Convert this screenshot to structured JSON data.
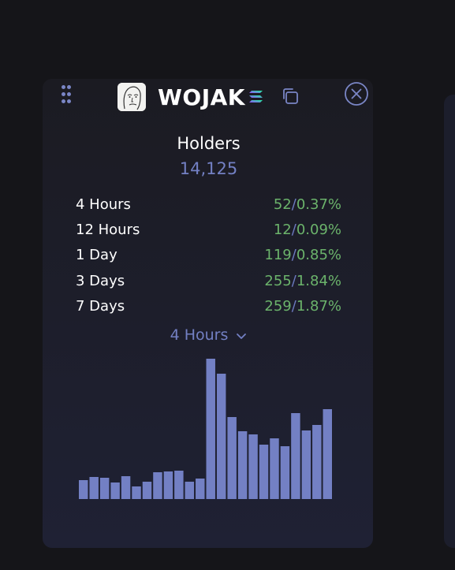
{
  "token": {
    "name": "WOJAK",
    "avatar_icon": "wojak-face-icon",
    "chain_icon": "solana-icon"
  },
  "holders": {
    "title": "Holders",
    "count": "14,125"
  },
  "stats": [
    {
      "label": "4 Hours",
      "count": "52",
      "percent": "0.37%"
    },
    {
      "label": "12 Hours",
      "count": "12",
      "percent": "0.09%"
    },
    {
      "label": "1 Day",
      "count": "119",
      "percent": "0.85%"
    },
    {
      "label": "3 Days",
      "count": "255",
      "percent": "1.84%"
    },
    {
      "label": "7 Days",
      "count": "259",
      "percent": "1.87%"
    }
  ],
  "period_select": {
    "selected": "4 Hours"
  },
  "colors": {
    "accent": "#7380c4",
    "positive": "#6bb36b",
    "card_bg": "#1b1b22",
    "page_bg": "#151519"
  },
  "chart_data": {
    "type": "bar",
    "values": [
      24,
      28,
      27,
      21,
      29,
      16,
      22,
      34,
      35,
      36,
      22,
      26,
      178,
      159,
      104,
      86,
      82,
      69,
      77,
      67,
      109,
      87,
      94,
      114
    ]
  }
}
